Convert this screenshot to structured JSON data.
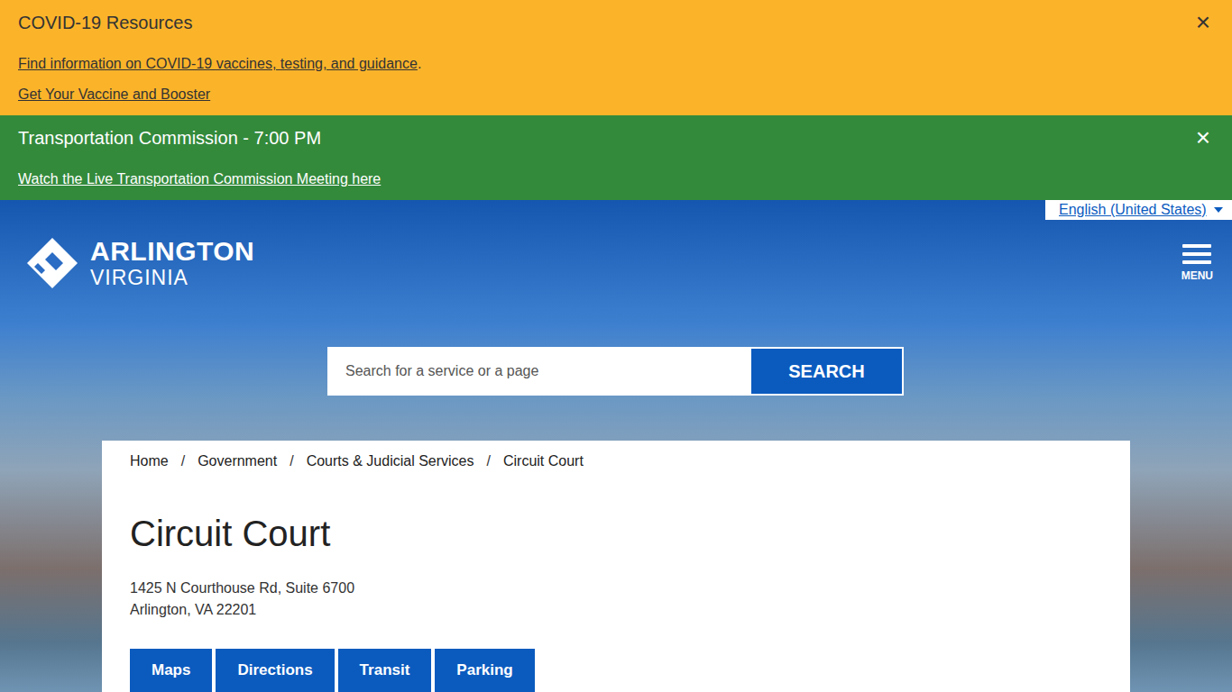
{
  "alerts": [
    {
      "title": "COVID-19 Resources",
      "links": [
        {
          "text": "Find information on COVID-19 vaccines, testing, and guidance",
          "suffix": "."
        },
        {
          "text": "Get Your Vaccine and Booster",
          "suffix": ""
        }
      ],
      "close": "×",
      "color": "#fbb42a",
      "dark": true
    },
    {
      "title": "Transportation Commission - 7:00 PM",
      "links": [
        {
          "text": "Watch the Live Transportation Commission Meeting here",
          "suffix": ""
        }
      ],
      "close": "×",
      "color": "#338a3b",
      "dark": false
    }
  ],
  "language": {
    "label": "English (United States)"
  },
  "logo": {
    "name": "ARLINGTON",
    "sub": "VIRGINIA"
  },
  "menu": {
    "label": "MENU"
  },
  "search": {
    "placeholder": "Search for a service or a page",
    "button": "SEARCH"
  },
  "breadcrumb": [
    "Home",
    "Government",
    "Courts & Judicial Services",
    "Circuit Court"
  ],
  "breadcrumb_separator": "/",
  "page": {
    "title": "Circuit Court",
    "address": [
      "1425 N Courthouse Rd, Suite 6700",
      "Arlington, VA 22201"
    ]
  },
  "actions": [
    "Maps",
    "Directions",
    "Transit",
    "Parking"
  ]
}
